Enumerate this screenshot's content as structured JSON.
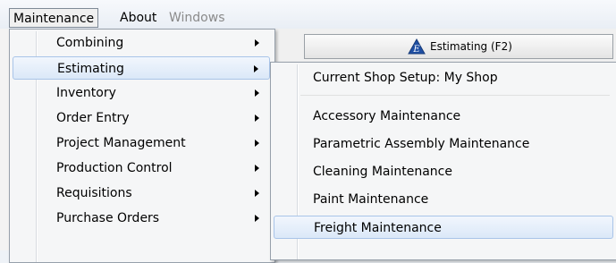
{
  "menubar": {
    "items": [
      {
        "label": "Maintenance",
        "state": "open"
      },
      {
        "label": "About",
        "state": "normal"
      },
      {
        "label": "Windows",
        "state": "disabled"
      }
    ]
  },
  "background": {
    "button_label": "Estimating (F2)",
    "icon": "estimating-e-icon"
  },
  "main_menu": {
    "items": [
      {
        "label": "Combining",
        "has_submenu": true,
        "highlighted": false
      },
      {
        "label": "Estimating",
        "has_submenu": true,
        "highlighted": true
      },
      {
        "label": "Inventory",
        "has_submenu": true,
        "highlighted": false
      },
      {
        "label": "Order Entry",
        "has_submenu": true,
        "highlighted": false
      },
      {
        "label": "Project Management",
        "has_submenu": true,
        "highlighted": false
      },
      {
        "label": "Production Control",
        "has_submenu": true,
        "highlighted": false
      },
      {
        "label": "Requisitions",
        "has_submenu": true,
        "highlighted": false
      },
      {
        "label": "Purchase Orders",
        "has_submenu": true,
        "highlighted": false
      }
    ]
  },
  "sub_menu": {
    "items": [
      {
        "label": "Current Shop Setup: My Shop",
        "highlighted": false
      },
      {
        "label": "Accessory Maintenance",
        "highlighted": false
      },
      {
        "label": "Parametric Assembly Maintenance",
        "highlighted": false
      },
      {
        "label": "Cleaning Maintenance",
        "highlighted": false
      },
      {
        "label": "Paint Maintenance",
        "highlighted": false
      },
      {
        "label": "Freight Maintenance",
        "highlighted": true
      }
    ]
  },
  "colors": {
    "highlight_border": "#a9c4e8",
    "highlight_fill": "#dbe8f8",
    "disabled_text": "#8a8a8a"
  }
}
